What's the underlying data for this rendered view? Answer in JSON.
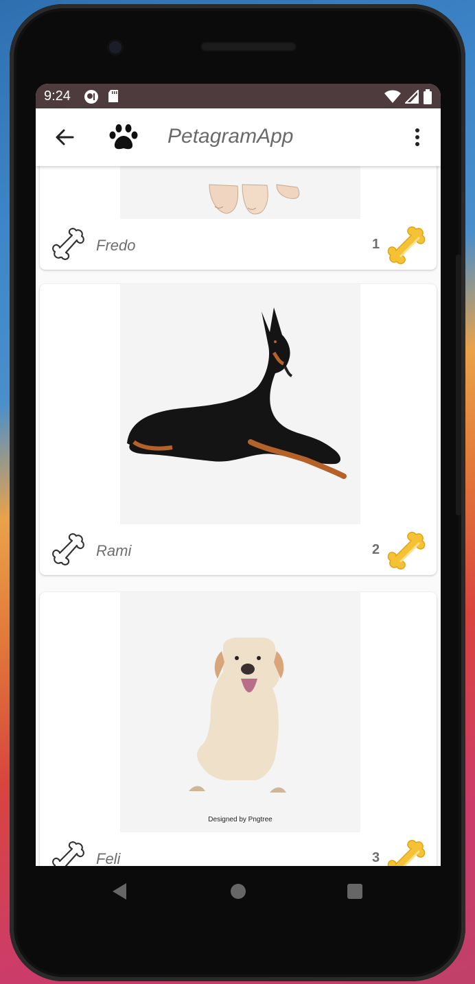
{
  "status_bar": {
    "time": "9:24"
  },
  "toolbar": {
    "title": "PetagramApp",
    "back_icon": "arrow-back-icon",
    "logo_icon": "paw-icon",
    "menu_icon": "more-vert-icon"
  },
  "pets": [
    {
      "name": "Fredo",
      "likes": "1"
    },
    {
      "name": "Rami",
      "likes": "2"
    },
    {
      "name": "Feli",
      "likes": "3",
      "photo_credit": "Designed by Pngtree"
    }
  ],
  "watermark": "Pngtree",
  "colors": {
    "status_bar": "#4e3b3d",
    "bone_gold": "#f5c236",
    "text_gray": "#6e6e6e"
  }
}
